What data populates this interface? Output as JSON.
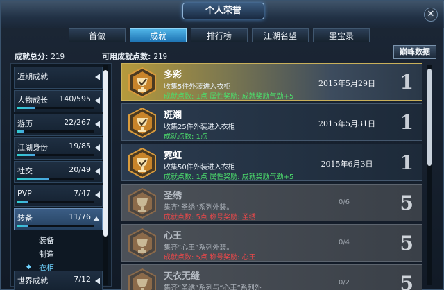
{
  "window": {
    "title": "个人荣誉",
    "close_glyph": "✕"
  },
  "tabs": [
    {
      "label": "首做",
      "active": false
    },
    {
      "label": "成就",
      "active": true
    },
    {
      "label": "排行榜",
      "active": false
    },
    {
      "label": "江湖名望",
      "active": false
    },
    {
      "label": "墨宝录",
      "active": false
    }
  ],
  "stats": {
    "total_label": "成就总分:",
    "total_value": "219",
    "available_label": "可用成就点数:",
    "available_value": "219"
  },
  "peak_button": {
    "label": "巅峰数据"
  },
  "sidebar": {
    "categories": [
      {
        "label": "近期成就",
        "count": "",
        "progress": 0
      },
      {
        "label": "人物成长",
        "count": "140/595",
        "progress": 0.235
      },
      {
        "label": "游历",
        "count": "22/267",
        "progress": 0.082
      },
      {
        "label": "江湖身份",
        "count": "19/85",
        "progress": 0.224
      },
      {
        "label": "社交",
        "count": "20/49",
        "progress": 0.408
      },
      {
        "label": "PVP",
        "count": "7/47",
        "progress": 0.149
      },
      {
        "label": "装备",
        "count": "11/76",
        "progress": 0.145
      },
      {
        "label": "世界成就",
        "count": "7/12",
        "progress": 0.583
      }
    ],
    "subitems": [
      {
        "label": "装备",
        "active": false
      },
      {
        "label": "制造",
        "active": false
      },
      {
        "label": "衣柜",
        "active": true
      }
    ],
    "marker_glyph": "◆"
  },
  "achievements": [
    {
      "name": "多彩",
      "desc": "收集5件外装进入衣柜",
      "reward": "成就点数: 1点 属性奖励: 成就奖励气劲+5",
      "date": "2015年5月29日",
      "progress": "",
      "points": "1",
      "state": "gold"
    },
    {
      "name": "斑斓",
      "desc": "收集25件外装进入衣柜",
      "reward": "成就点数: 1点",
      "date": "2015年5月31日",
      "progress": "",
      "points": "1",
      "state": "done"
    },
    {
      "name": "霓虹",
      "desc": "收集50件外装进入衣柜",
      "reward": "成就点数: 1点 属性奖励: 成就奖励气劲+5",
      "date": "2015年6月3日",
      "progress": "",
      "points": "1",
      "state": "done"
    },
    {
      "name": "圣绣",
      "desc": "集齐“圣绣”系列外装。",
      "reward": "成就点数: 5点 称号奖励: 圣绣",
      "date": "",
      "progress": "0/6",
      "points": "5",
      "state": "locked"
    },
    {
      "name": "心王",
      "desc": "集齐“心王”系列外装。",
      "reward": "成就点数: 5点 称号奖励: 心王",
      "date": "",
      "progress": "0/4",
      "points": "5",
      "state": "locked"
    },
    {
      "name": "天衣无缝",
      "desc": "集齐“圣绣”系列与“心王”系列外",
      "reward": "",
      "date": "",
      "progress": "0/2",
      "points": "5",
      "state": "locked"
    }
  ],
  "colors": {
    "tab_active": "#2f8fd0",
    "reward_done": "#4cdc6c",
    "reward_locked": "#e8484a",
    "badge_done": "#c8842a",
    "badge_locked": "#8b6a4a"
  },
  "icons": {
    "badge": "trophy-cup-icon",
    "close": "close-icon",
    "collapse": "arrow-left-icon",
    "expand": "arrow-down-icon"
  }
}
